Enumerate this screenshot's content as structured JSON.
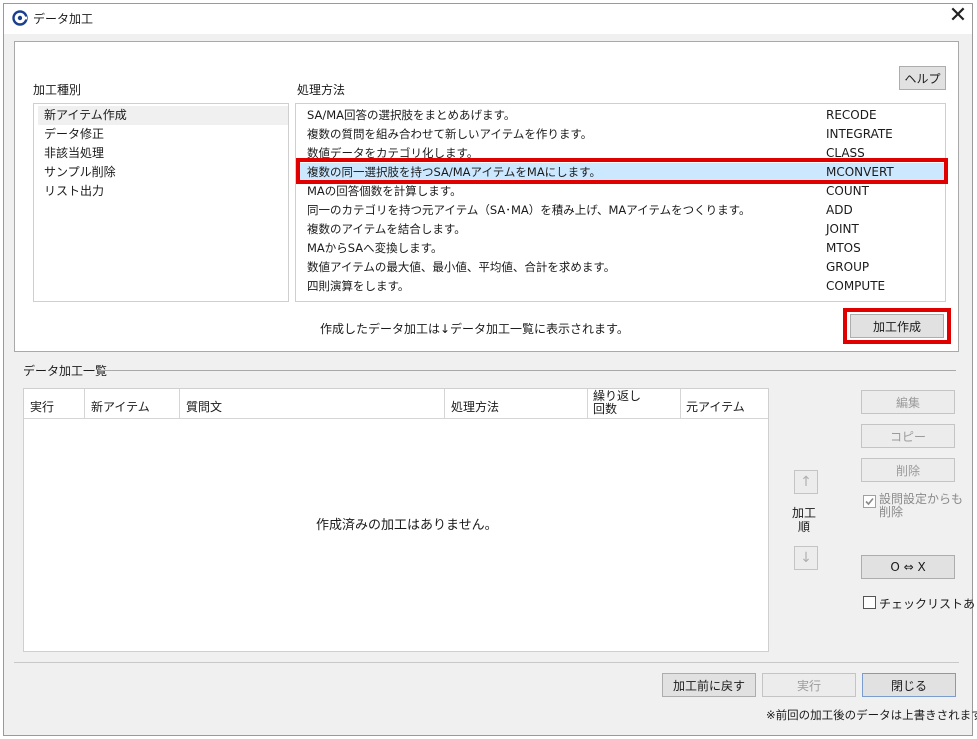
{
  "window": {
    "title": "データ加工",
    "close_glyph": "✕"
  },
  "help_button": "ヘルプ",
  "categories": {
    "header": "加工種別",
    "items": [
      "新アイテム作成",
      "データ修正",
      "非該当処理",
      "サンプル削除",
      "リスト出力"
    ],
    "selected_index": 0
  },
  "methods": {
    "header": "処理方法",
    "items": [
      {
        "desc": "SA/MA回答の選択肢をまとめあげます。",
        "code": "RECODE"
      },
      {
        "desc": "複数の質問を組み合わせて新しいアイテムを作ります。",
        "code": "INTEGRATE"
      },
      {
        "desc": "数値データをカテゴリ化します。",
        "code": "CLASS"
      },
      {
        "desc": "複数の同一選択肢を持つSA/MAアイテムをMAにします。",
        "code": "MCONVERT"
      },
      {
        "desc": "MAの回答個数を計算します。",
        "code": "COUNT"
      },
      {
        "desc": "同一のカテゴリを持つ元アイテム（SA･MA）を積み上げ、MAアイテムをつくります。",
        "code": "ADD"
      },
      {
        "desc": "複数のアイテムを結合します。",
        "code": "JOINT"
      },
      {
        "desc": "MAからSAへ変換します。",
        "code": "MTOS"
      },
      {
        "desc": "数値アイテムの最大値、最小値、平均値、合計を求めます。",
        "code": "GROUP"
      },
      {
        "desc": "四則演算をします。",
        "code": "COMPUTE"
      }
    ],
    "selected_index": 3
  },
  "info_text": "作成したデータ加工は↓データ加工一覧に表示されます。",
  "create_button": "加工作成",
  "list_section": {
    "title": "データ加工一覧",
    "columns": [
      "実行",
      "新アイテム",
      "質問文",
      "処理方法",
      "繰り返し\n回数",
      "元アイテム"
    ],
    "columns_repeat_line1": "繰り返し",
    "columns_repeat_line2": "回数",
    "empty_message": "作成済みの加工はありません。"
  },
  "order": {
    "label_line1": "加工",
    "label_line2": "順",
    "up_glyph": "↑",
    "down_glyph": "↓"
  },
  "side_buttons": {
    "edit": "編集",
    "copy": "コピー",
    "delete": "削除",
    "delete_from_settings_line1": "設問設定からも",
    "delete_from_settings_line2": "削除",
    "delete_from_settings_checked": true,
    "swap": "O ⇔ X",
    "checklist": "チェックリストあり",
    "checklist_checked": false
  },
  "footer": {
    "revert": "加工前に戻す",
    "run": "実行",
    "close": "閉じる",
    "note": "※前回の加工後のデータは上書きされます。"
  },
  "colors": {
    "highlight_border": "#e00000",
    "selected_row": "#cce8ff",
    "app_icon": "#1b3f8f"
  }
}
